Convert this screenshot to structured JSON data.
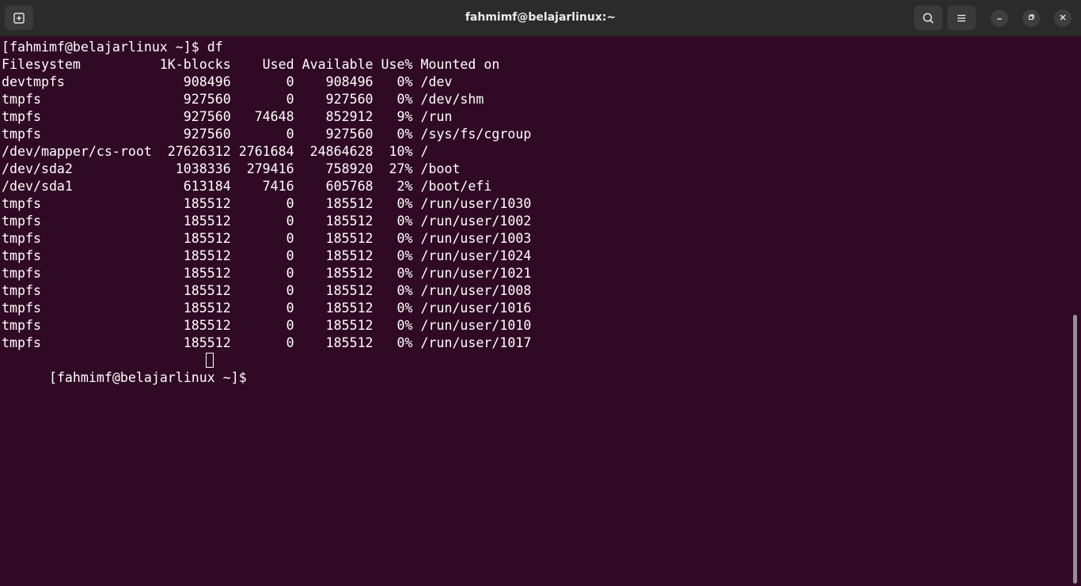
{
  "window": {
    "title": "fahmimf@belajarlinux:~"
  },
  "icons": {
    "new_tab": "new-tab-icon",
    "search": "search-icon",
    "menu": "hamburger-menu-icon",
    "minimize": "minimize-icon",
    "restore": "restore-icon",
    "close": "close-icon"
  },
  "colors": {
    "terminal_background": "#300a24",
    "titlebar_background": "#2b2b2b",
    "text": "#ffffff"
  },
  "terminal": {
    "lines": [
      "[fahmimf@belajarlinux ~]$ df",
      "Filesystem          1K-blocks    Used Available Use% Mounted on",
      "devtmpfs               908496       0    908496   0% /dev",
      "tmpfs                  927560       0    927560   0% /dev/shm",
      "tmpfs                  927560   74648    852912   9% /run",
      "tmpfs                  927560       0    927560   0% /sys/fs/cgroup",
      "/dev/mapper/cs-root  27626312 2761684  24864628  10% /",
      "/dev/sda2             1038336  279416    758920  27% /boot",
      "/dev/sda1              613184    7416    605768   2% /boot/efi",
      "tmpfs                  185512       0    185512   0% /run/user/1030",
      "tmpfs                  185512       0    185512   0% /run/user/1002",
      "tmpfs                  185512       0    185512   0% /run/user/1003",
      "tmpfs                  185512       0    185512   0% /run/user/1024",
      "tmpfs                  185512       0    185512   0% /run/user/1021",
      "tmpfs                  185512       0    185512   0% /run/user/1008",
      "tmpfs                  185512       0    185512   0% /run/user/1016",
      "tmpfs                  185512       0    185512   0% /run/user/1010",
      "tmpfs                  185512       0    185512   0% /run/user/1017"
    ],
    "prompt": "[fahmimf@belajarlinux ~]$ "
  }
}
